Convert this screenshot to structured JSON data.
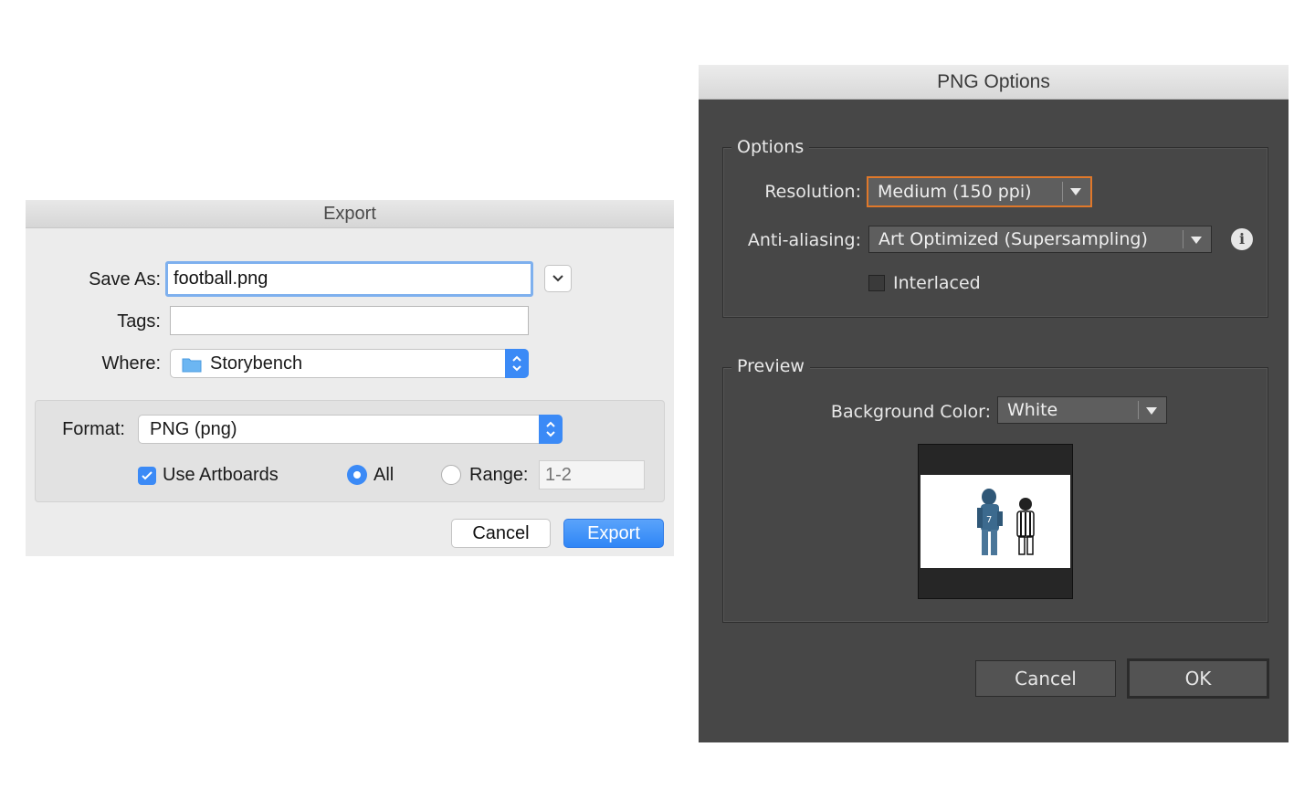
{
  "export_dialog": {
    "title": "Export",
    "save_as": {
      "label": "Save As:",
      "value": "football.png"
    },
    "tags": {
      "label": "Tags:",
      "value": ""
    },
    "where": {
      "label": "Where:",
      "value": "Storybench"
    },
    "format": {
      "label": "Format:",
      "value": "PNG (png)"
    },
    "use_artboards": {
      "label": "Use Artboards",
      "checked": true
    },
    "all_radio": {
      "label": "All",
      "selected": true
    },
    "range_radio": {
      "label": "Range:",
      "selected": false,
      "placeholder": "1-2"
    },
    "buttons": {
      "cancel": "Cancel",
      "export": "Export"
    },
    "accent_color": "#3b8af6"
  },
  "png_dialog": {
    "title": "PNG Options",
    "options_group": {
      "title": "Options",
      "resolution": {
        "label": "Resolution:",
        "value": "Medium (150 ppi)"
      },
      "anti_aliasing": {
        "label": "Anti-aliasing:",
        "value": "Art Optimized (Supersampling)"
      },
      "interlaced": {
        "label": "Interlaced",
        "checked": false
      }
    },
    "preview_group": {
      "title": "Preview",
      "background_color": {
        "label": "Background Color:",
        "value": "White"
      }
    },
    "buttons": {
      "cancel": "Cancel",
      "ok": "OK"
    },
    "highlight_color": "#e0782a"
  }
}
